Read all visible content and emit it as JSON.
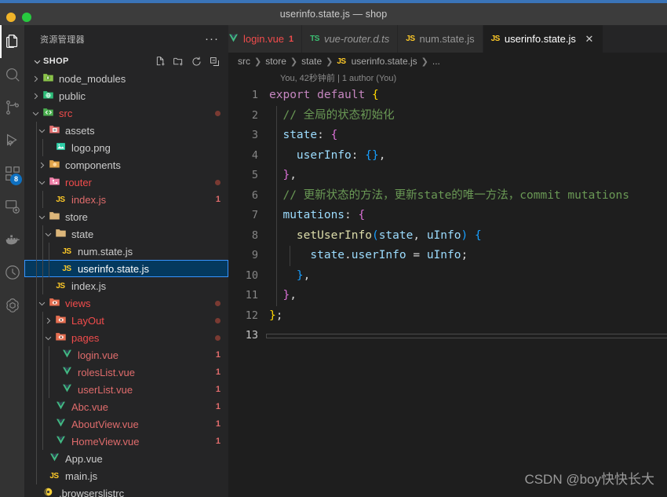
{
  "window": {
    "title": "userinfo.state.js — shop",
    "accent_blue": "#3a74b8",
    "titlebar_bg": "#3c3c3c"
  },
  "activity_bar": {
    "items": [
      {
        "name": "explorer-icon",
        "label": "Explorer",
        "active": true,
        "badge": null
      },
      {
        "name": "search-icon",
        "label": "Search",
        "active": false,
        "badge": null
      },
      {
        "name": "source-control-icon",
        "label": "Source Control",
        "active": false,
        "badge": null
      },
      {
        "name": "run-debug-icon",
        "label": "Run and Debug",
        "active": false,
        "badge": null
      },
      {
        "name": "extensions-icon",
        "label": "Extensions",
        "active": false,
        "badge": "8"
      },
      {
        "name": "remote-explorer-icon",
        "label": "Remote Explorer",
        "active": false,
        "badge": null
      },
      {
        "name": "docker-icon",
        "label": "Docker",
        "active": false,
        "badge": null
      },
      {
        "name": "timeline-icon",
        "label": "Timeline",
        "active": false,
        "badge": null
      },
      {
        "name": "copilot-icon",
        "label": "Copilot",
        "active": false,
        "badge": null
      }
    ]
  },
  "sidebar": {
    "header_title": "资源管理器",
    "more_actions": "···",
    "section": {
      "name": "SHOP",
      "expanded": true,
      "actions": [
        {
          "name": "new-file-icon",
          "label": "New File"
        },
        {
          "name": "new-folder-icon",
          "label": "New Folder"
        },
        {
          "name": "refresh-icon",
          "label": "Refresh Explorer"
        },
        {
          "name": "collapse-all-icon",
          "label": "Collapse Folders in Explorer"
        }
      ]
    },
    "tree": [
      {
        "label": "node_modules",
        "type": "folder",
        "icon": "folder-node-icon",
        "depth": 0,
        "twist": "collapsed",
        "color": "default",
        "badge": "",
        "dot": false
      },
      {
        "label": "public",
        "type": "folder",
        "icon": "folder-public-icon",
        "depth": 0,
        "twist": "collapsed",
        "color": "default",
        "badge": "",
        "dot": false
      },
      {
        "label": "src",
        "type": "folder",
        "icon": "folder-src-icon",
        "depth": 0,
        "twist": "expanded",
        "color": "err",
        "badge": "",
        "dot": true
      },
      {
        "label": "assets",
        "type": "folder",
        "icon": "folder-assets-icon",
        "depth": 1,
        "twist": "expanded",
        "color": "default",
        "badge": "",
        "dot": false
      },
      {
        "label": "logo.png",
        "type": "file",
        "icon": "image-file-icon",
        "depth": 2,
        "twist": "none",
        "color": "default",
        "badge": "",
        "dot": false
      },
      {
        "label": "components",
        "type": "folder",
        "icon": "folder-components-icon",
        "depth": 1,
        "twist": "collapsed",
        "color": "default",
        "badge": "",
        "dot": false
      },
      {
        "label": "router",
        "type": "folder",
        "icon": "folder-router-icon",
        "depth": 1,
        "twist": "expanded",
        "color": "err",
        "badge": "",
        "dot": true
      },
      {
        "label": "index.js",
        "type": "file",
        "icon": "js-file-icon",
        "depth": 2,
        "twist": "none",
        "color": "errsoft",
        "badge": "1",
        "dot": false
      },
      {
        "label": "store",
        "type": "folder",
        "icon": "folder-icon",
        "depth": 1,
        "twist": "expanded",
        "color": "default",
        "badge": "",
        "dot": false
      },
      {
        "label": "state",
        "type": "folder",
        "icon": "folder-icon",
        "depth": 2,
        "twist": "expanded",
        "color": "default",
        "badge": "",
        "dot": false
      },
      {
        "label": "num.state.js",
        "type": "file",
        "icon": "js-file-icon",
        "depth": 3,
        "twist": "none",
        "color": "default",
        "badge": "",
        "dot": false
      },
      {
        "label": "userinfo.state.js",
        "type": "file",
        "icon": "js-file-icon",
        "depth": 3,
        "twist": "none",
        "color": "default",
        "badge": "",
        "dot": false,
        "selected": true
      },
      {
        "label": "index.js",
        "type": "file",
        "icon": "js-file-icon",
        "depth": 2,
        "twist": "none",
        "color": "default",
        "badge": "",
        "dot": false
      },
      {
        "label": "views",
        "type": "folder",
        "icon": "folder-views-icon",
        "depth": 1,
        "twist": "expanded",
        "color": "err",
        "badge": "",
        "dot": true
      },
      {
        "label": "LayOut",
        "type": "folder",
        "icon": "folder-views-icon",
        "depth": 2,
        "twist": "collapsed",
        "color": "err",
        "badge": "",
        "dot": true
      },
      {
        "label": "pages",
        "type": "folder",
        "icon": "folder-views-icon",
        "depth": 2,
        "twist": "expanded",
        "color": "err",
        "badge": "",
        "dot": true
      },
      {
        "label": "login.vue",
        "type": "file",
        "icon": "vue-file-icon",
        "depth": 3,
        "twist": "none",
        "color": "errsoft",
        "badge": "1",
        "dot": false
      },
      {
        "label": "rolesList.vue",
        "type": "file",
        "icon": "vue-file-icon",
        "depth": 3,
        "twist": "none",
        "color": "errsoft",
        "badge": "1",
        "dot": false
      },
      {
        "label": "userList.vue",
        "type": "file",
        "icon": "vue-file-icon",
        "depth": 3,
        "twist": "none",
        "color": "errsoft",
        "badge": "1",
        "dot": false
      },
      {
        "label": "Abc.vue",
        "type": "file",
        "icon": "vue-file-icon",
        "depth": 2,
        "twist": "none",
        "color": "errsoft",
        "badge": "1",
        "dot": false
      },
      {
        "label": "AboutView.vue",
        "type": "file",
        "icon": "vue-file-icon",
        "depth": 2,
        "twist": "none",
        "color": "errsoft",
        "badge": "1",
        "dot": false
      },
      {
        "label": "HomeView.vue",
        "type": "file",
        "icon": "vue-file-icon",
        "depth": 2,
        "twist": "none",
        "color": "errsoft",
        "badge": "1",
        "dot": false
      },
      {
        "label": "App.vue",
        "type": "file",
        "icon": "vue-file-icon",
        "depth": 1,
        "twist": "none",
        "color": "default",
        "badge": "",
        "dot": false
      },
      {
        "label": "main.js",
        "type": "file",
        "icon": "js-file-icon",
        "depth": 1,
        "twist": "none",
        "color": "default",
        "badge": "",
        "dot": false
      },
      {
        "label": ".browserslistrc",
        "type": "file",
        "icon": "browserslist-icon",
        "depth": 0,
        "twist": "none",
        "color": "default",
        "badge": "",
        "dot": false
      }
    ]
  },
  "editor": {
    "tabs": [
      {
        "label": "login.vue",
        "icon": "vue-file-icon",
        "badge": "1",
        "active": false,
        "italic": false,
        "error": true,
        "clipped": true
      },
      {
        "label": "vue-router.d.ts",
        "icon": "ts-file-icon",
        "badge": "",
        "active": false,
        "italic": true,
        "error": false,
        "clipped": false
      },
      {
        "label": "num.state.js",
        "icon": "js-file-icon",
        "badge": "",
        "active": false,
        "italic": false,
        "error": false,
        "clipped": false
      },
      {
        "label": "userinfo.state.js",
        "icon": "js-file-icon",
        "badge": "",
        "active": true,
        "italic": false,
        "error": false,
        "clipped": false,
        "close": "✕"
      }
    ],
    "breadcrumb": [
      "src",
      "store",
      "state",
      "userinfo.state.js",
      "..."
    ],
    "breadcrumb_file_icon": "js-file-icon",
    "blame": "You, 42秒钟前 | 1 author (You)",
    "lines": [
      {
        "n": "1",
        "tokens": [
          {
            "t": "export ",
            "c": "t-kw"
          },
          {
            "t": "default ",
            "c": "t-kw"
          },
          {
            "t": "{",
            "c": "t-brace1"
          }
        ]
      },
      {
        "n": "2",
        "tokens": [
          {
            "t": "  // 全局的状态初始化",
            "c": "t-cmt"
          }
        ]
      },
      {
        "n": "3",
        "tokens": [
          {
            "t": "  ",
            "c": "t-plain"
          },
          {
            "t": "state",
            "c": "t-prop"
          },
          {
            "t": ": ",
            "c": "t-plain"
          },
          {
            "t": "{",
            "c": "t-brace2"
          }
        ]
      },
      {
        "n": "4",
        "tokens": [
          {
            "t": "    ",
            "c": "t-plain"
          },
          {
            "t": "userInfo",
            "c": "t-prop"
          },
          {
            "t": ": ",
            "c": "t-plain"
          },
          {
            "t": "{}",
            "c": "t-brace3"
          },
          {
            "t": ",",
            "c": "t-plain"
          }
        ]
      },
      {
        "n": "5",
        "tokens": [
          {
            "t": "  ",
            "c": "t-plain"
          },
          {
            "t": "}",
            "c": "t-brace2"
          },
          {
            "t": ",",
            "c": "t-plain"
          }
        ]
      },
      {
        "n": "6",
        "tokens": [
          {
            "t": "  // 更新状态的方法，更新state的唯一方法，commit mutations",
            "c": "t-cmt"
          }
        ]
      },
      {
        "n": "7",
        "tokens": [
          {
            "t": "  ",
            "c": "t-plain"
          },
          {
            "t": "mutations",
            "c": "t-prop"
          },
          {
            "t": ": ",
            "c": "t-plain"
          },
          {
            "t": "{",
            "c": "t-brace2"
          }
        ]
      },
      {
        "n": "8",
        "tokens": [
          {
            "t": "    ",
            "c": "t-plain"
          },
          {
            "t": "setUserInfo",
            "c": "t-fn"
          },
          {
            "t": "(",
            "c": "t-brace3"
          },
          {
            "t": "state",
            "c": "t-param"
          },
          {
            "t": ", ",
            "c": "t-plain"
          },
          {
            "t": "uInfo",
            "c": "t-param"
          },
          {
            "t": ")",
            "c": "t-brace3"
          },
          {
            "t": " ",
            "c": "t-plain"
          },
          {
            "t": "{",
            "c": "t-brace3"
          }
        ]
      },
      {
        "n": "9",
        "tokens": [
          {
            "t": "      ",
            "c": "t-plain"
          },
          {
            "t": "state",
            "c": "t-prop"
          },
          {
            "t": ".",
            "c": "t-plain"
          },
          {
            "t": "userInfo",
            "c": "t-prop"
          },
          {
            "t": " = ",
            "c": "t-plain"
          },
          {
            "t": "uInfo",
            "c": "t-prop"
          },
          {
            "t": ";",
            "c": "t-plain"
          }
        ]
      },
      {
        "n": "10",
        "tokens": [
          {
            "t": "    ",
            "c": "t-plain"
          },
          {
            "t": "}",
            "c": "t-brace3"
          },
          {
            "t": ",",
            "c": "t-plain"
          }
        ]
      },
      {
        "n": "11",
        "tokens": [
          {
            "t": "  ",
            "c": "t-plain"
          },
          {
            "t": "}",
            "c": "t-brace2"
          },
          {
            "t": ",",
            "c": "t-plain"
          }
        ]
      },
      {
        "n": "12",
        "tokens": [
          {
            "t": "",
            "c": "t-plain"
          },
          {
            "t": "}",
            "c": "t-brace1"
          },
          {
            "t": ";",
            "c": "t-plain"
          }
        ]
      },
      {
        "n": "13",
        "tokens": [],
        "current": true
      }
    ]
  },
  "watermark": "CSDN @boy快快长大"
}
